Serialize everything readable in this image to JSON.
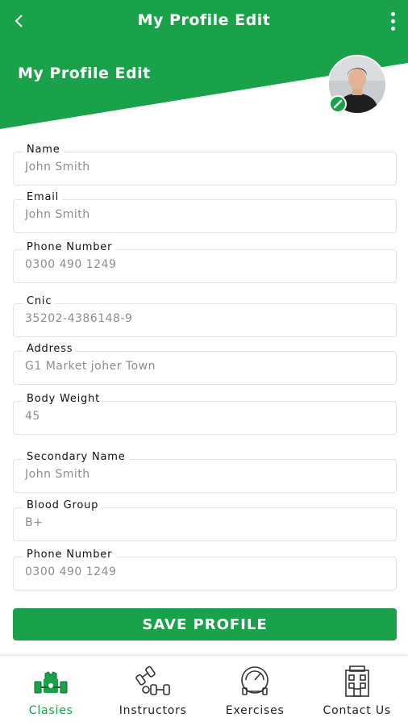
{
  "colors": {
    "brand": "#1aa24a",
    "text_muted": "#8d8d8d",
    "border": "#e3e3e3"
  },
  "header": {
    "title": "My Profile Edit",
    "section_title": "My Profile Edit",
    "back_icon": "chevron-left-icon",
    "more_icon": "more-vertical-icon"
  },
  "profile": {
    "avatar_icon": "user-avatar",
    "edit_icon": "pencil-icon"
  },
  "form": {
    "fields": [
      {
        "label": "Name",
        "value": "John Smith"
      },
      {
        "label": "Email",
        "value": "John Smith"
      },
      {
        "label": "Phone Number",
        "value": "0300 490 1249"
      },
      {
        "label": "Cnic",
        "value": "35202-4386148-9"
      },
      {
        "label": "Address",
        "value": "G1 Market joher Town"
      },
      {
        "label": "Body Weight",
        "value": "45"
      },
      {
        "label": "Secondary Name",
        "value": "John Smith"
      },
      {
        "label": "Blood Group",
        "value": "B+"
      },
      {
        "label": "Phone Number",
        "value": "0300 490 1249"
      }
    ],
    "save_label": "SAVE PROFILE"
  },
  "nav": {
    "items": [
      {
        "label": "Clasies",
        "icon": "gym-classes-icon",
        "active": true
      },
      {
        "label": "Instructors",
        "icon": "dumbbells-icon",
        "active": false
      },
      {
        "label": "Exercises",
        "icon": "treadmill-speed-icon",
        "active": false
      },
      {
        "label": "Contact Us",
        "icon": "building-icon",
        "active": false
      }
    ]
  }
}
